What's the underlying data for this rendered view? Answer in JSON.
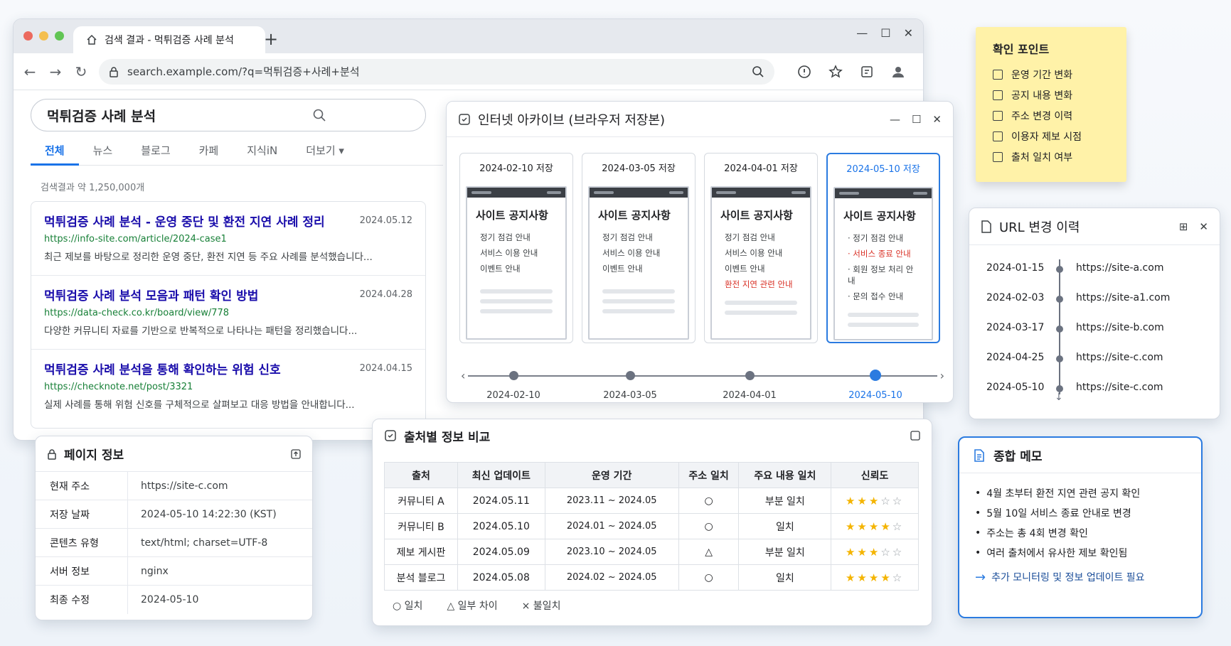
{
  "browser": {
    "tab_title": "검색 결과 - 먹튀검증 사례 분석",
    "new_tab": "+",
    "url": "search.example.com/?q=먹튀검증+사례+분석",
    "search_query": "먹튀검증 사례 분석",
    "tabs": [
      "전체",
      "뉴스",
      "블로그",
      "카페",
      "지식iN",
      "더보기 ▾"
    ],
    "result_count": "검색결과 약 1,250,000개",
    "results": [
      {
        "title": "먹튀검증 사례 분석 - 운영 중단 및 환전 지연 사례 정리",
        "date": "2024.05.12",
        "url": "https://info-site.com/article/2024-case1",
        "snippet": "최근 제보를 바탕으로 정리한 운영 중단, 환전 지연 등 주요 사례를 분석했습니다..."
      },
      {
        "title": "먹튀검증 사례 분석 모음과 패턴 확인 방법",
        "date": "2024.04.28",
        "url": "https://data-check.co.kr/board/view/778",
        "snippet": "다양한 커뮤니티 자료를 기반으로 반복적으로 나타나는 패턴을 정리했습니다..."
      },
      {
        "title": "먹튀검증 사례 분석을 통해 확인하는 위험 신호",
        "date": "2024.04.15",
        "url": "https://checknote.net/post/3321",
        "snippet": "실제 사례를 통해 위험 신호를 구체적으로 살펴보고 대응 방법을 안내합니다..."
      }
    ]
  },
  "archive": {
    "title": "인터넷 아카이브 (브라우저 저장본)",
    "snapshots": [
      {
        "label": "2024-02-10 저장",
        "heading": "사이트 공지사항",
        "items": [
          "정기 점검 안내",
          "서비스 이용 안내",
          "이벤트 안내"
        ],
        "selected": false
      },
      {
        "label": "2024-03-05 저장",
        "heading": "사이트 공지사항",
        "items": [
          "정기 점검 안내",
          "서비스 이용 안내",
          "이벤트 안내"
        ],
        "selected": false
      },
      {
        "label": "2024-04-01 저장",
        "heading": "사이트 공지사항",
        "items": [
          "정기 점검 안내",
          "서비스 이용 안내",
          "이벤트 안내",
          "환전 지연 관련 안내"
        ],
        "selected": false
      },
      {
        "label": "2024-05-10 저장",
        "heading": "사이트 공지사항",
        "items": [
          "· 정기 점검 안내",
          "· 서비스 종료 안내",
          "· 회원 정보 처리 안내",
          "· 문의 접수 안내"
        ],
        "selected": true
      }
    ],
    "timeline": [
      "2024-02-10",
      "2024-03-05",
      "2024-04-01",
      "2024-05-10"
    ]
  },
  "sticky": {
    "title": "확인 포인트",
    "items": [
      "운영 기간 변화",
      "공지 내용 변화",
      "주소 변경 이력",
      "이용자 제보 시점",
      "출처 일치 여부"
    ]
  },
  "url_history": {
    "title": "URL 변경 이력",
    "rows": [
      {
        "date": "2024-01-15",
        "url": "https://site-a.com"
      },
      {
        "date": "2024-02-03",
        "url": "https://site-a1.com"
      },
      {
        "date": "2024-03-17",
        "url": "https://site-b.com"
      },
      {
        "date": "2024-04-25",
        "url": "https://site-c.com"
      },
      {
        "date": "2024-05-10",
        "url": "https://site-c.com"
      }
    ]
  },
  "page_info": {
    "title": "페이지 정보",
    "rows": [
      {
        "k": "현재 주소",
        "v": "https://site-c.com"
      },
      {
        "k": "저장 날짜",
        "v": "2024-05-10 14:22:30 (KST)"
      },
      {
        "k": "콘텐츠 유형",
        "v": "text/html; charset=UTF-8"
      },
      {
        "k": "서버 정보",
        "v": "nginx"
      },
      {
        "k": "최종 수정",
        "v": "2024-05-10"
      }
    ]
  },
  "compare": {
    "title": "출처별 정보 비교",
    "headers": [
      "출처",
      "최신 업데이트",
      "운영 기간",
      "주소 일치",
      "주요 내용 일치",
      "신뢰도"
    ],
    "rows": [
      {
        "source": "커뮤니티 A",
        "updated": "2024.05.11",
        "period": "2023.11 ~ 2024.05",
        "addr": "○",
        "content": "부분 일치",
        "stars": 3
      },
      {
        "source": "커뮤니티 B",
        "updated": "2024.05.10",
        "period": "2024.01 ~ 2024.05",
        "addr": "○",
        "content": "일치",
        "stars": 4
      },
      {
        "source": "제보 게시판",
        "updated": "2024.05.09",
        "period": "2023.10 ~ 2024.05",
        "addr": "△",
        "content": "부분 일치",
        "stars": 3
      },
      {
        "source": "분석 블로그",
        "updated": "2024.05.08",
        "period": "2024.02 ~ 2024.05",
        "addr": "○",
        "content": "일치",
        "stars": 4
      }
    ],
    "legend": [
      "○ 일치",
      "△ 일부 차이",
      "× 불일치"
    ]
  },
  "memo": {
    "title": "종합 메모",
    "items": [
      "4월 초부터 환전 지연 관련 공지 확인",
      "5월 10일 서비스 종료 안내로 변경",
      "주소는 총 4회 변경 확인",
      "여러 출처에서 유사한 제보 확인됨"
    ],
    "action": "추가 모니터링 및 정보 업데이트 필요"
  },
  "colors": {
    "accent": "#1a73e8",
    "link": "#1a0dab",
    "url_green": "#188038",
    "alert_red": "#d93025",
    "sticky": "#fff2a8",
    "star": "#f4b400"
  }
}
